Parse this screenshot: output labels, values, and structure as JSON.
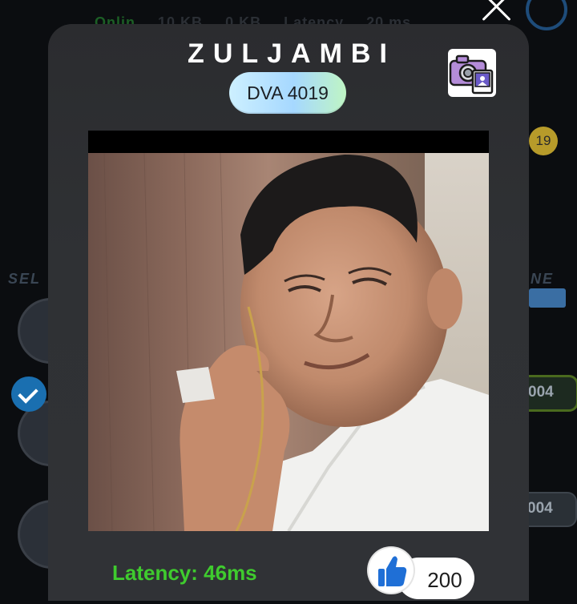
{
  "background": {
    "status_segments": [
      "Onlin",
      "10 KB",
      "0 KB",
      "Latency",
      "20 ms"
    ],
    "left_ghost_text": "SEL",
    "right_ghost_text": "H NE",
    "notification_count": "19",
    "pill_values": [
      "004",
      "004"
    ]
  },
  "modal": {
    "title": "ZULJAMBI",
    "code": "DVA 4019",
    "camera_icon": "camera-gallery-icon",
    "photo_alt": "profile photo",
    "latency": "Latency: 46ms",
    "like_icon": "thumbs-up-icon",
    "like_count": "200"
  },
  "colors": {
    "latency_green": "#3fcb2e",
    "modal_bg": "#2f3134",
    "pill_gradient_start": "#cdf0ff",
    "pill_gradient_end": "#bff5c4",
    "like_blue": "#1f6fd6"
  }
}
